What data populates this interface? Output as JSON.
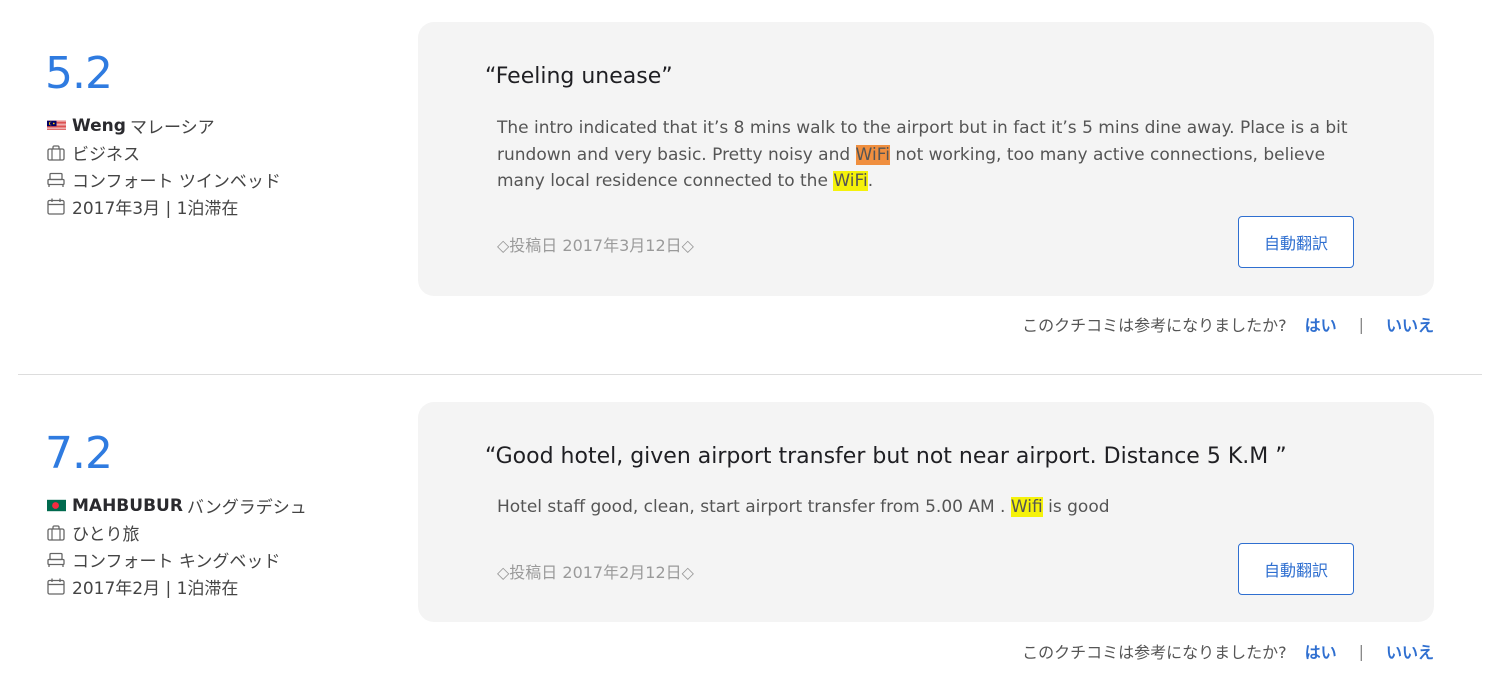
{
  "reviews": [
    {
      "score": "5.2",
      "reviewer": "Weng",
      "country": "マレーシア",
      "flag": "malaysia-flag",
      "traveler_type": "ビジネス",
      "room_type": "コンフォート ツインベッド",
      "stay": "2017年3月 | 1泊滞在",
      "title": "“Feeling unease”",
      "body": {
        "p1": "The intro indicated that it’s 8 mins walk to the airport but in fact it’s 5 mins dine away. Place is a bit rundown and very basic. Pretty noisy and ",
        "hl1": "WiFi",
        "p2": " not working, too many active connections, believe many local residence connected to the ",
        "hl2": "WiFi",
        "p3": "."
      },
      "posted": "◇投稿日 2017年3月12日◇",
      "translate_label": "自動翻訳",
      "helpful_question": "このクチコミは参考になりましたか?",
      "yes_label": "はい",
      "separator": "|",
      "no_label": "いいえ"
    },
    {
      "score": "7.2",
      "reviewer": "MAHBUBUR",
      "country": "バングラデシュ",
      "flag": "bangladesh-flag",
      "traveler_type": "ひとり旅",
      "room_type": "コンフォート キングベッド",
      "stay": "2017年2月 | 1泊滞在",
      "title": "“Good hotel, given airport transfer but not near airport. Distance 5 K.M ”",
      "body": {
        "p1": "Hotel staff good, clean, start airport transfer from 5.00 AM . ",
        "hl1": "Wifi",
        "p2": " is good"
      },
      "posted": "◇投稿日 2017年2月12日◇",
      "translate_label": "自動翻訳",
      "helpful_question": "このクチコミは参考になりましたか?",
      "yes_label": "はい",
      "separator": "|",
      "no_label": "いいえ"
    }
  ],
  "colors": {
    "score": "#2f7be0",
    "link": "#2f6fd0",
    "card_bg": "#f4f4f4",
    "highlight_orange": "#f08f3f",
    "highlight_yellow": "#f5f20a"
  },
  "icons": [
    "briefcase-icon",
    "bed-icon",
    "calendar-icon"
  ]
}
